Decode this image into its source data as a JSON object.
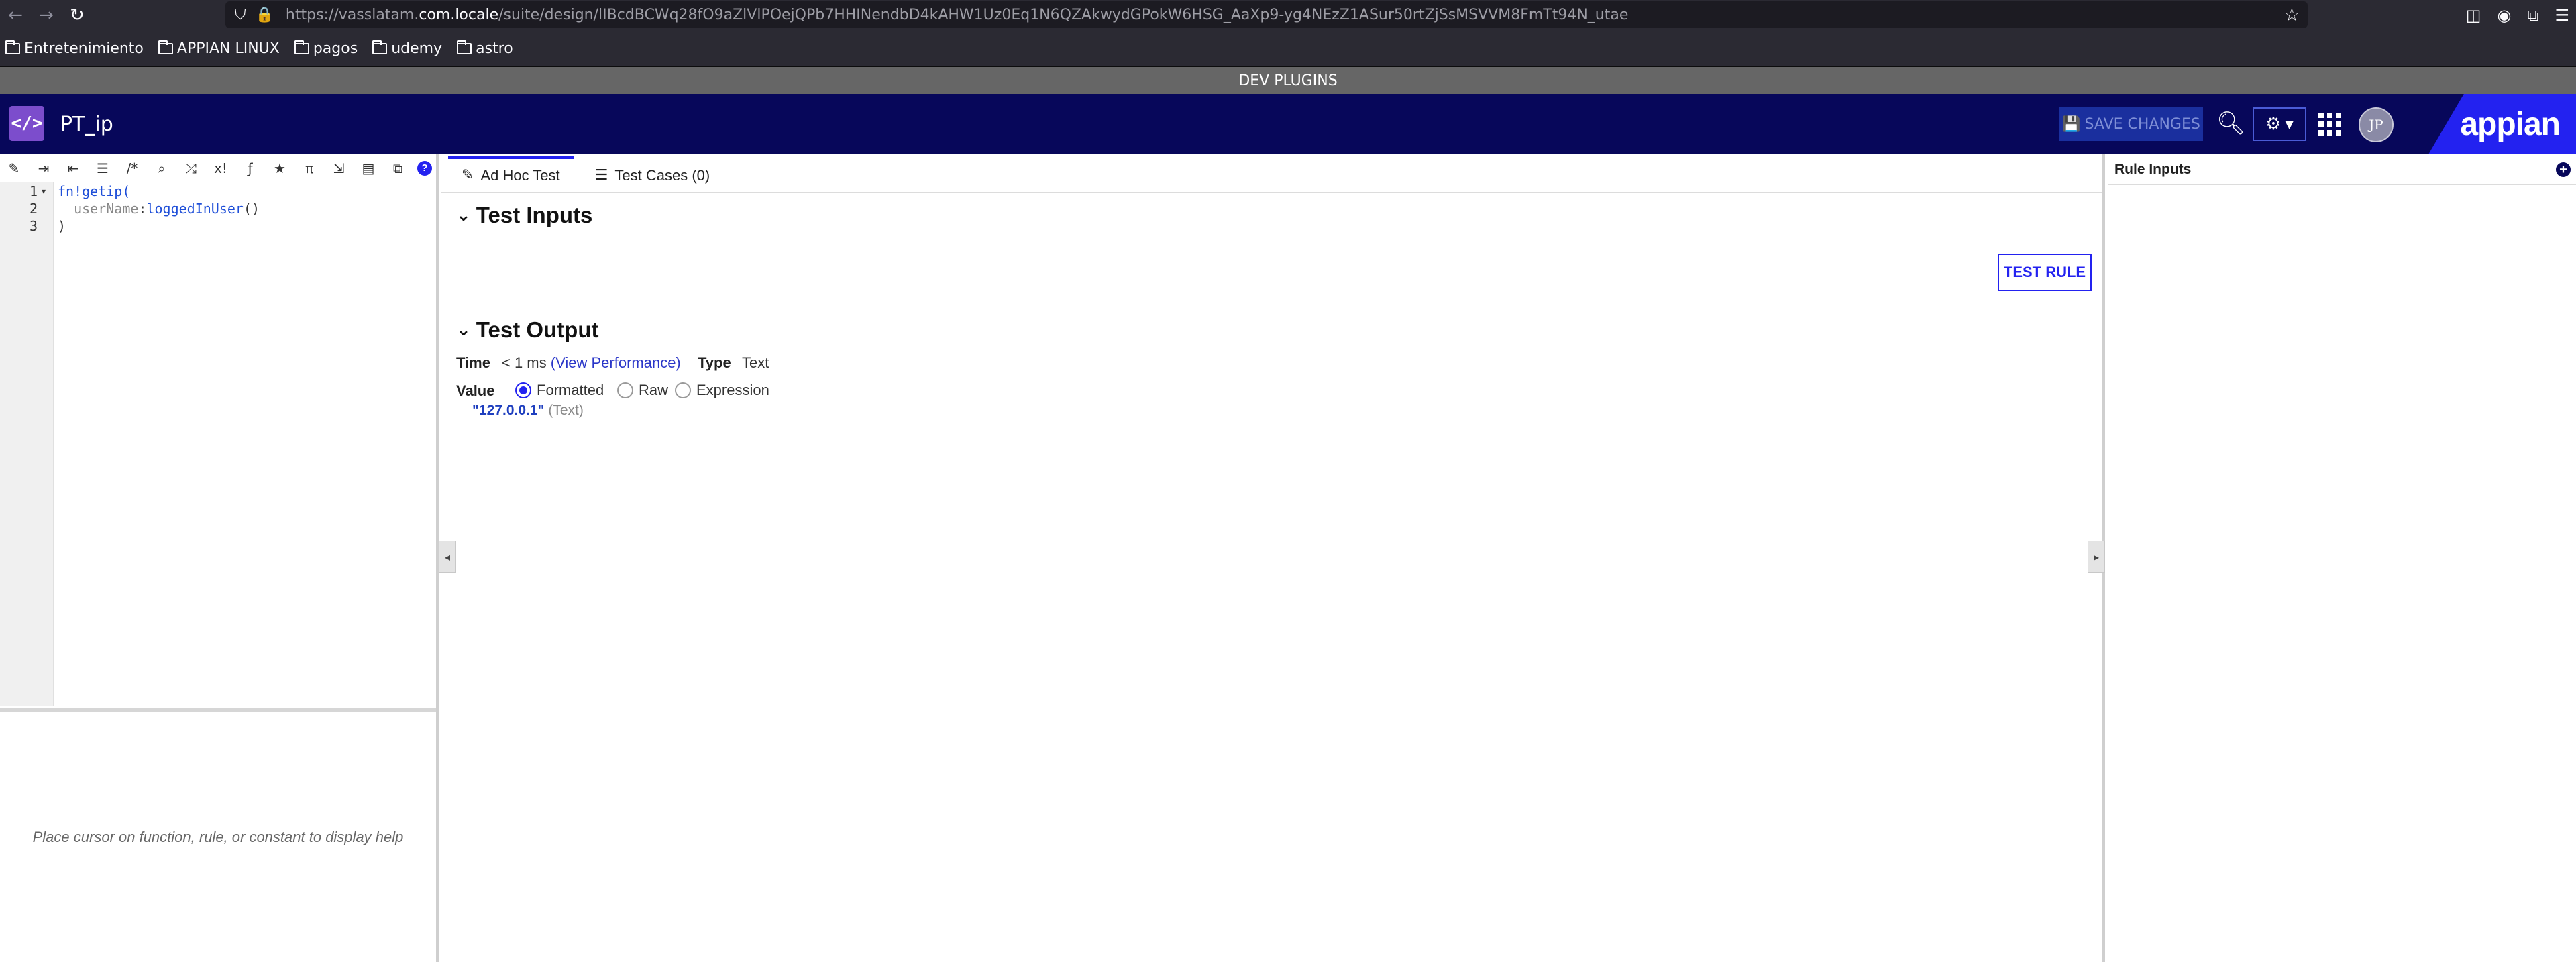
{
  "browser": {
    "url_prefix": "https://vasslatam.",
    "url_domain": "com.locale",
    "url_rest": "/suite/design/lIBcdBCWq28fO9aZlVlPOejQPb7HHINendbD4kAHW1Uz0Eq1N6QZAkwydGPokW6HSG_AaXp9-yg4NEzZ1ASur50rtZjSsMSVVM8FmTt94N_utae"
  },
  "bookmarks": [
    {
      "label": "Entretenimiento"
    },
    {
      "label": "APPIAN LINUX"
    },
    {
      "label": "pagos"
    },
    {
      "label": "udemy"
    },
    {
      "label": "astro"
    }
  ],
  "devbar": {
    "label": "DEV PLUGINS"
  },
  "header": {
    "app_title": "PT_ip",
    "save_label": "SAVE CHANGES",
    "avatar_initials": "JP",
    "logo_text": "appian"
  },
  "editor": {
    "line_numbers": [
      "1",
      "2",
      "3"
    ],
    "code": {
      "line1_fn": "fn!getip(",
      "line2_param": "  userName",
      "line2_sep": ":",
      "line2_call": "loggedInUser",
      "line2_parens": "()",
      "line3": ")"
    },
    "help_text": "Place cursor on function, rule, or constant to display help"
  },
  "tabs": [
    {
      "label": "Ad Hoc Test",
      "icon": "edit-icon",
      "active": true
    },
    {
      "label": "Test Cases (0)",
      "icon": "list-icon",
      "active": false
    }
  ],
  "test_inputs": {
    "title": "Test Inputs",
    "test_rule_label": "TEST RULE"
  },
  "test_output": {
    "title": "Test Output",
    "time_label": "Time",
    "time_value": "< 1 ms",
    "view_performance": "(View Performance)",
    "type_label": "Type",
    "type_value": "Text",
    "value_label": "Value",
    "radio_options": [
      "Formatted",
      "Raw",
      "Expression"
    ],
    "selected_option": "Formatted",
    "output_string": "\"127.0.0.1\"",
    "output_type": "(Text)"
  },
  "rule_inputs": {
    "title": "Rule Inputs"
  },
  "colors": {
    "header_bg": "#07075a",
    "accent": "#2322f0",
    "logo_bg": "#2322f0",
    "devbar_bg": "#666666"
  }
}
